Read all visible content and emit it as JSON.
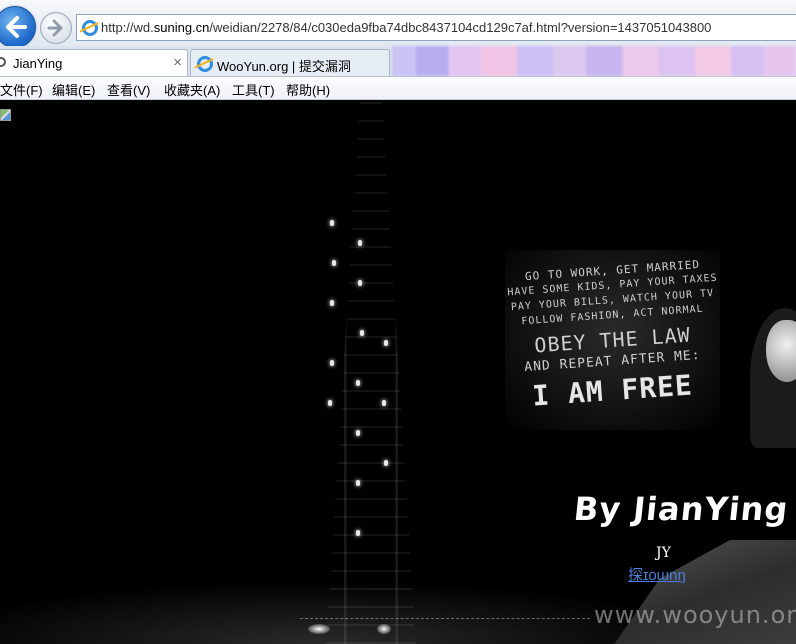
{
  "browser": {
    "url_prefix": "http://wd.",
    "url_domain": "suning.cn",
    "url_rest": "/weidian/2278/84/c030eda9fba74dbc8437104cd129c7af.html?version=1437051043800",
    "tabs": [
      {
        "label": "JianYing",
        "active": true
      },
      {
        "label": "WooYun.org | 提交漏洞",
        "active": false
      }
    ],
    "close_glyph": "×",
    "menu": [
      "文件(F)",
      "编辑(E)",
      "查看(V)",
      "收藏夹(A)",
      "工具(T)",
      "帮助(H)"
    ]
  },
  "page": {
    "poster_lines": [
      "GO TO WORK, GET MARRIED",
      "HAVE SOME KIDS, PAY YOUR TAXES",
      "PAY YOUR BILLS, WATCH YOUR TV",
      "FOLLOW FASHION, ACT NORMAL",
      "OBEY THE LAW",
      "AND REPEAT AFTER ME:",
      "I AM FREE"
    ],
    "title": "By JianYing",
    "subtitle": "JY",
    "link_text": "探ɪoɯnŋ",
    "watermark": "www.wooyun.org"
  },
  "colors": {
    "accent_blue": "#1b66c9",
    "link": "#4a7fd8",
    "page_bg": "#000000"
  }
}
